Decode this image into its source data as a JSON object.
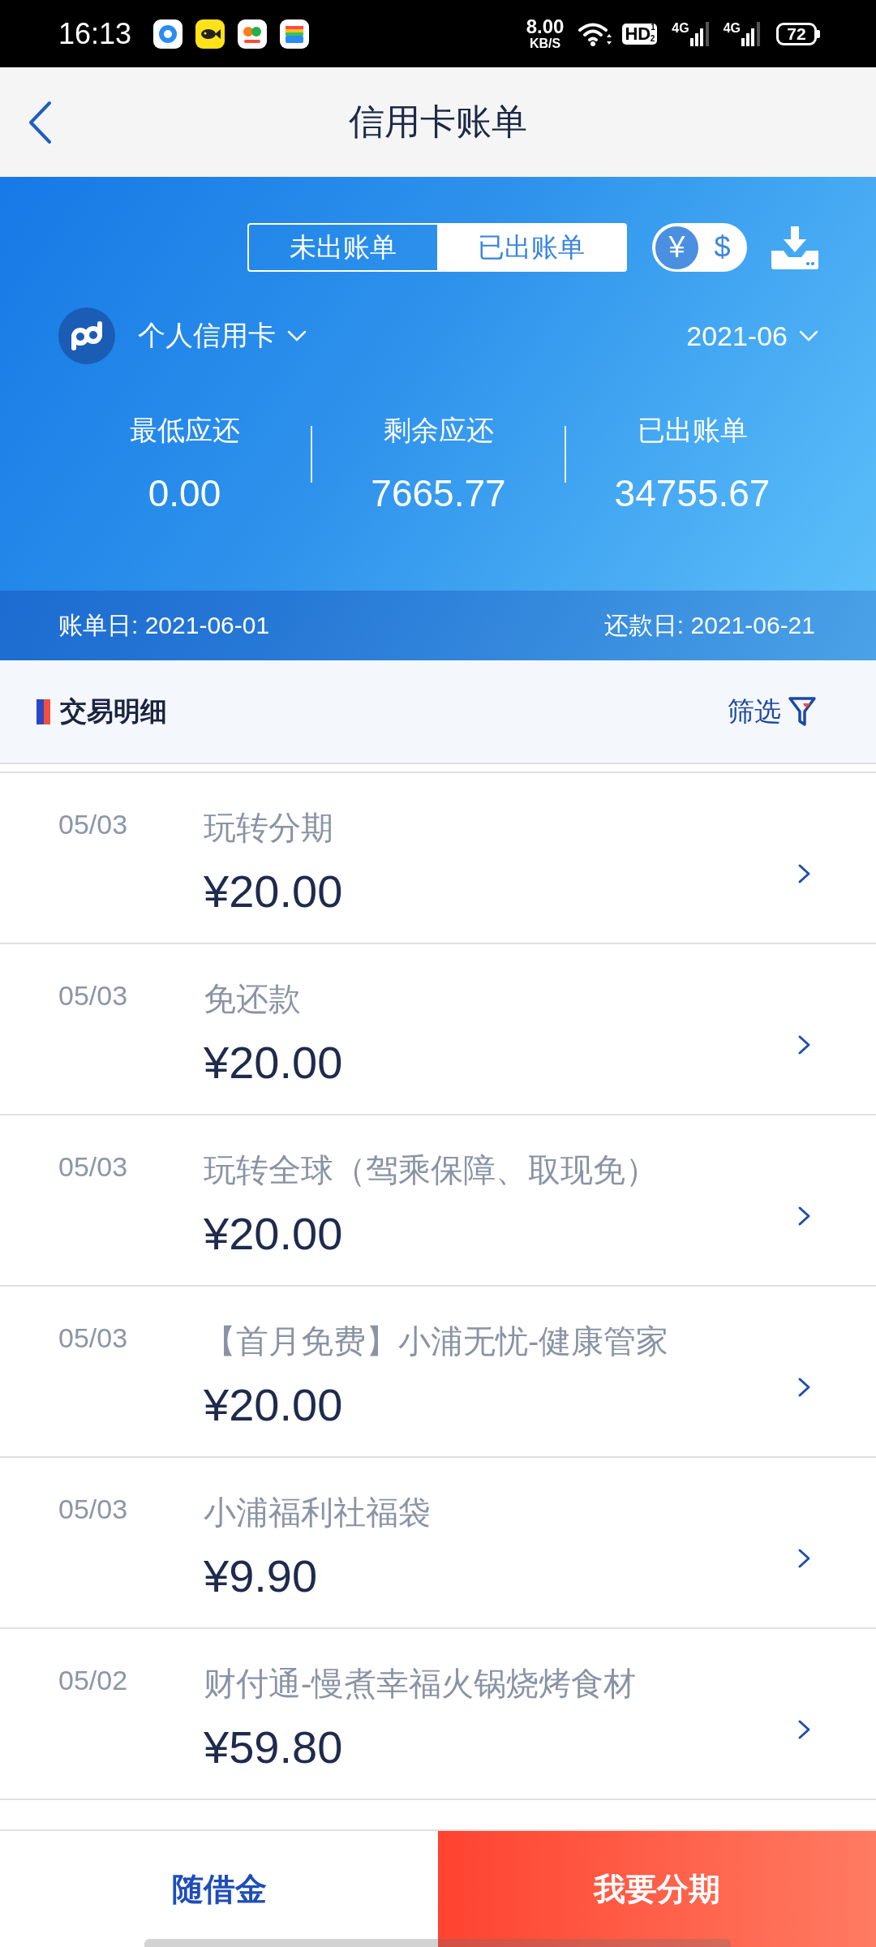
{
  "status_bar": {
    "time": "16:13",
    "net_speed": "8.00",
    "net_speed_unit": "KB/S",
    "hd_label": "HD$^{1}$$_{2}$",
    "networks": [
      "4G",
      "4G"
    ],
    "battery": "72"
  },
  "nav_bar": {
    "title": "信用卡账单"
  },
  "bill_tabs": [
    {
      "label": "未出账单",
      "selected": false
    },
    {
      "label": "已出账单",
      "selected": true
    }
  ],
  "currency_options": [
    {
      "symbol": "¥",
      "selected": true
    },
    {
      "symbol": "$",
      "selected": false
    }
  ],
  "card_selector": {
    "label": "个人信用卡"
  },
  "month_selector": {
    "value": "2021-06"
  },
  "summary": [
    {
      "label": "最低应还",
      "value": "0.00"
    },
    {
      "label": "剩余应还",
      "value": "7665.77"
    },
    {
      "label": "已出账单",
      "value": "34755.67"
    }
  ],
  "statement_date": "账单日: 2021-06-01",
  "due_date": "还款日: 2021-06-21",
  "transactions_header": {
    "title": "交易明细",
    "filter_label": "筛选"
  },
  "transactions": [
    {
      "date": "05/03",
      "title": "玩转分期",
      "amount": "¥20.00"
    },
    {
      "date": "05/03",
      "title": "免还款",
      "amount": "¥20.00"
    },
    {
      "date": "05/03",
      "title": "玩转全球（驾乘保障、取现免）",
      "amount": "¥20.00"
    },
    {
      "date": "05/03",
      "title": "【首月免费】小浦无忧-健康管家",
      "amount": "¥20.00"
    },
    {
      "date": "05/03",
      "title": "小浦福利社福袋",
      "amount": "¥9.90"
    },
    {
      "date": "05/02",
      "title": "财付通-慢煮幸福火锅烧烤食材",
      "amount": "¥59.80"
    }
  ],
  "bottom_bar": [
    {
      "label": "随借金",
      "kind": "secondary"
    },
    {
      "label": "我要分期",
      "kind": "primary"
    }
  ]
}
